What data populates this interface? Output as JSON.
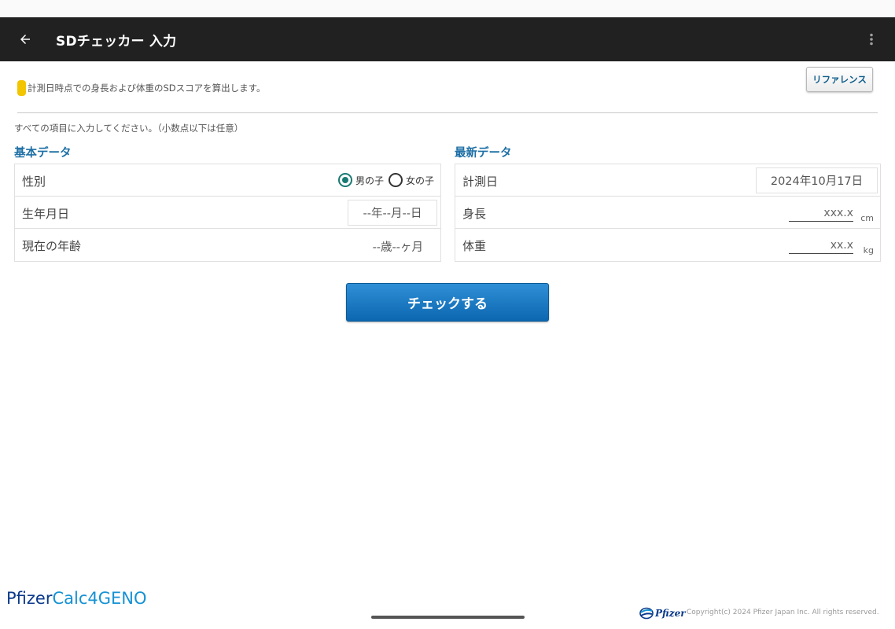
{
  "app": {
    "title": "SDチェッカー 入力",
    "reference_label": "リファレンス"
  },
  "note": "計測日時点での身長および体重のSDスコアを算出します。",
  "instruction": "すべての項目に入力してください。（小数点以下は任意）",
  "basic": {
    "title": "基本データ",
    "sex_label": "性別",
    "sex_options": [
      "男の子",
      "女の子"
    ],
    "sex_selected": "男の子",
    "birth_label": "生年月日",
    "birth_value": "--年--月--日",
    "age_label": "現在の年齢",
    "age_value": "--歳--ヶ月"
  },
  "latest": {
    "title": "最新データ",
    "date_label": "計測日",
    "date_value": "2024年10月17日",
    "height_label": "身長",
    "height_placeholder": "xxx.x",
    "height_unit": "cm",
    "weight_label": "体重",
    "weight_placeholder": "xx.x",
    "weight_unit": "kg"
  },
  "check_button": "チェックする",
  "footer": {
    "brand_part1": "Pfizer",
    "brand_part2": "Calc4GENO",
    "logo_text": "Pfizer",
    "copyright": "Copyright(c) 2024 Pfizer Japan Inc. All rights reserved."
  },
  "colors": {
    "appbar": "#212121",
    "accent_title": "#1d6fa5",
    "primary_button": "#0c67b0",
    "radio_selected": "#1a7a73",
    "note_marker": "#f2c500"
  }
}
